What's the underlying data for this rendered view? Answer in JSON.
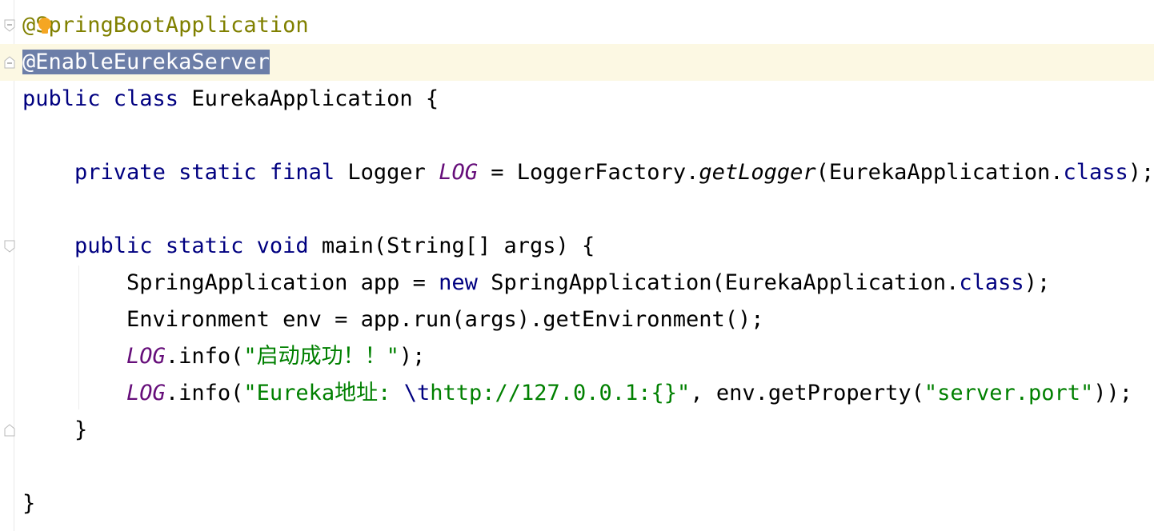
{
  "editor": {
    "lines": [
      {
        "tokens": [
          {
            "t": "@SpringBootApplication",
            "c": "ann"
          }
        ]
      },
      {
        "tokens": [
          {
            "t": "@EnableEurekaServer",
            "c": "sel"
          }
        ]
      },
      {
        "tokens": [
          {
            "t": "public class ",
            "c": "kw"
          },
          {
            "t": "EurekaApplication {",
            "c": ""
          }
        ]
      },
      {
        "tokens": []
      },
      {
        "tokens": [
          {
            "t": "    ",
            "c": ""
          },
          {
            "t": "private static final ",
            "c": "kw"
          },
          {
            "t": "Logger ",
            "c": ""
          },
          {
            "t": "LOG",
            "c": "static"
          },
          {
            "t": " = LoggerFactory.",
            "c": ""
          },
          {
            "t": "getLogger",
            "c": "italic"
          },
          {
            "t": "(EurekaApplication.",
            "c": ""
          },
          {
            "t": "class",
            "c": "kw"
          },
          {
            "t": ");",
            "c": ""
          }
        ]
      },
      {
        "tokens": []
      },
      {
        "tokens": [
          {
            "t": "    ",
            "c": ""
          },
          {
            "t": "public static void ",
            "c": "kw"
          },
          {
            "t": "main(String[] args) {",
            "c": ""
          }
        ]
      },
      {
        "tokens": [
          {
            "t": "        SpringApplication app = ",
            "c": ""
          },
          {
            "t": "new ",
            "c": "kw"
          },
          {
            "t": "SpringApplication(EurekaApplication.",
            "c": ""
          },
          {
            "t": "class",
            "c": "kw"
          },
          {
            "t": ");",
            "c": ""
          }
        ]
      },
      {
        "tokens": [
          {
            "t": "        Environment env = app.run(args).getEnvironment();",
            "c": ""
          }
        ]
      },
      {
        "tokens": [
          {
            "t": "        ",
            "c": ""
          },
          {
            "t": "LOG",
            "c": "static"
          },
          {
            "t": ".info(",
            "c": ""
          },
          {
            "t": "\"启动成功！！\"",
            "c": "str"
          },
          {
            "t": ");",
            "c": ""
          }
        ]
      },
      {
        "tokens": [
          {
            "t": "        ",
            "c": ""
          },
          {
            "t": "LOG",
            "c": "static"
          },
          {
            "t": ".info(",
            "c": ""
          },
          {
            "t": "\"Eureka地址: ",
            "c": "str"
          },
          {
            "t": "\\t",
            "c": "esc"
          },
          {
            "t": "http://127.0.0.1:{}\"",
            "c": "str"
          },
          {
            "t": ", env.getProperty(",
            "c": ""
          },
          {
            "t": "\"server.port\"",
            "c": "str"
          },
          {
            "t": "));",
            "c": ""
          }
        ]
      },
      {
        "tokens": [
          {
            "t": "    }",
            "c": ""
          }
        ]
      },
      {
        "tokens": []
      },
      {
        "tokens": [
          {
            "t": "}",
            "c": ""
          }
        ]
      }
    ]
  },
  "icons": {
    "intention_bulb": "lightbulb-icon",
    "fold": "fold-marker-icon"
  },
  "colors": {
    "keyword": "#000080",
    "annotation": "#808000",
    "static_field": "#660e7a",
    "string": "#008000",
    "selection": "#6c7ea8",
    "current_line": "#fcf8e3",
    "bulb": "#f5a623"
  }
}
